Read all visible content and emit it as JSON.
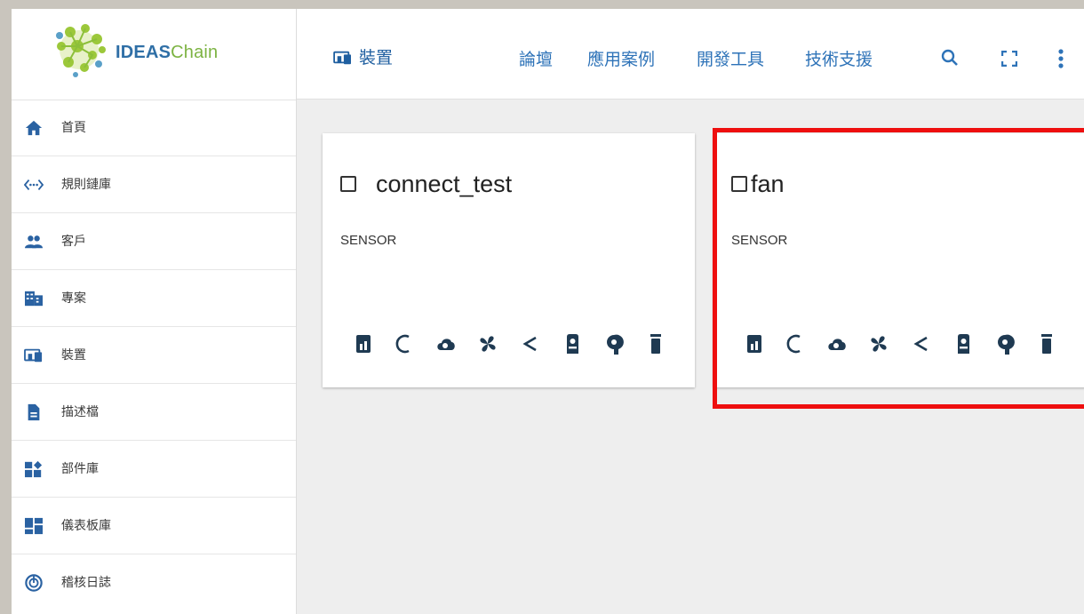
{
  "brand": {
    "name_bold": "IDEAS",
    "name_light": "Chain"
  },
  "header": {
    "title": "裝置",
    "links": [
      "論壇",
      "應用案例",
      "開發工具",
      "技術支援"
    ],
    "icons": [
      "search-icon",
      "fullscreen-icon",
      "more-vert-icon"
    ]
  },
  "sidebar": {
    "items": [
      {
        "label": "首頁",
        "icon": "home-icon"
      },
      {
        "label": "規則鏈庫",
        "icon": "code-brackets-icon"
      },
      {
        "label": "客戶",
        "icon": "people-icon"
      },
      {
        "label": "專案",
        "icon": "building-icon"
      },
      {
        "label": "裝置",
        "icon": "devices-icon"
      },
      {
        "label": "描述檔",
        "icon": "document-icon"
      },
      {
        "label": "部件庫",
        "icon": "widgets-icon"
      },
      {
        "label": "儀表板庫",
        "icon": "dashboard-icon"
      },
      {
        "label": "稽核日誌",
        "icon": "track-changes-icon"
      }
    ]
  },
  "devices": [
    {
      "name": "connect_test",
      "type": "SENSOR",
      "selected": false
    },
    {
      "name": "fan",
      "type": "SENSOR",
      "selected": false,
      "highlighted": true
    }
  ],
  "card_actions": [
    "dashboard-icon",
    "refresh-icon",
    "cloud-icon",
    "fan-icon",
    "share-icon",
    "assign-icon",
    "unassign-icon",
    "delete-icon"
  ],
  "colors": {
    "accent": "#1f5fa0",
    "link": "#2e73b8",
    "highlight": "#ee0f0f",
    "background": "#eeeeee"
  }
}
